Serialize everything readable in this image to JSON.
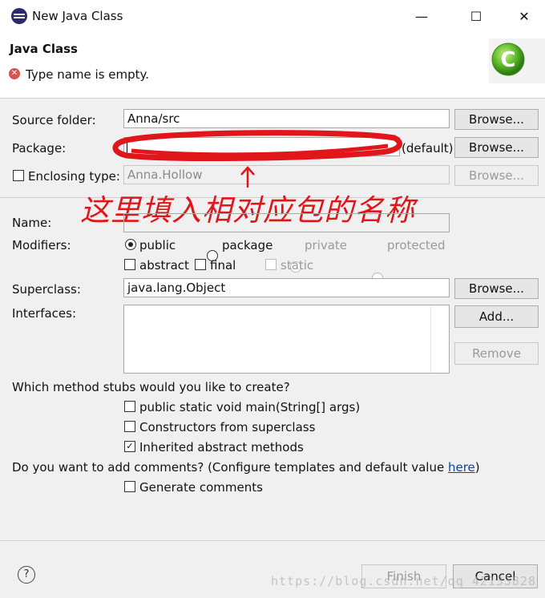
{
  "window": {
    "title": "New Java Class",
    "minimize_glyph": "—",
    "maximize_glyph": "☐",
    "close_glyph": "✕",
    "app_icon": "eclipse-icon"
  },
  "header": {
    "title": "Java Class",
    "message": "Type name is empty.",
    "message_icon": "error-icon",
    "logo_icon": "java-class-logo-icon"
  },
  "form": {
    "source_folder": {
      "label": "Source folder:",
      "value": "Anna/src",
      "button": "Browse..."
    },
    "package": {
      "label": "Package:",
      "value": "",
      "suffix": "(default)",
      "button": "Browse..."
    },
    "enclosing_type": {
      "label": "Enclosing type:",
      "value": "Anna.Hollow",
      "button": "Browse...",
      "checked": false
    },
    "name": {
      "label": "Name:",
      "value": ""
    },
    "modifiers": {
      "label": "Modifiers:",
      "radios": [
        {
          "label": "public",
          "checked": true,
          "enabled": true
        },
        {
          "label": "package",
          "checked": false,
          "enabled": true
        },
        {
          "label": "private",
          "checked": false,
          "enabled": false
        },
        {
          "label": "protected",
          "checked": false,
          "enabled": false
        }
      ],
      "checks": [
        {
          "label": "abstract",
          "checked": false,
          "enabled": true
        },
        {
          "label": "final",
          "checked": false,
          "enabled": true
        },
        {
          "label": "static",
          "checked": false,
          "enabled": false
        }
      ]
    },
    "superclass": {
      "label": "Superclass:",
      "value": "java.lang.Object",
      "button": "Browse..."
    },
    "interfaces": {
      "label": "Interfaces:",
      "add_button": "Add...",
      "remove_button": "Remove"
    },
    "stubs": {
      "question": "Which method stubs would you like to create?",
      "options": [
        {
          "label": "public static void main(String[] args)",
          "checked": false
        },
        {
          "label": "Constructors from superclass",
          "checked": false
        },
        {
          "label": "Inherited abstract methods",
          "checked": true
        }
      ]
    },
    "comments": {
      "question": "Do you want to add comments? (Configure templates and default value ",
      "link": "here",
      "question_end": ")",
      "option": {
        "label": "Generate comments",
        "checked": false
      }
    }
  },
  "annotation": {
    "text": "这里填入相对应包的名称",
    "color": "#e0161b"
  },
  "footer": {
    "help_glyph": "?",
    "finish_button": "Finish",
    "cancel_button": "Cancel",
    "watermark": "https://blog.csdn.net/qq_42133828"
  }
}
